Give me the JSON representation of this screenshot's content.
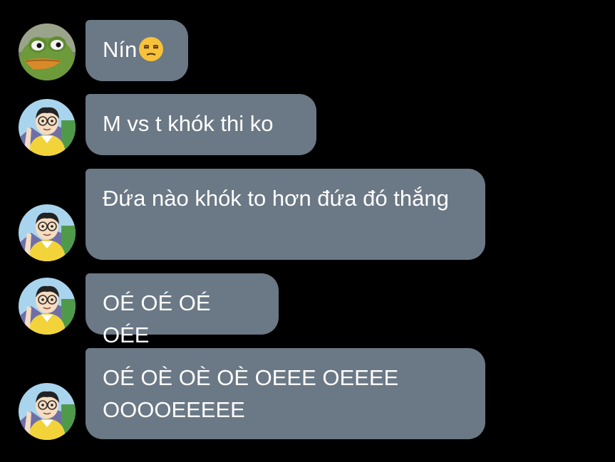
{
  "messages": [
    {
      "text": "Nín",
      "emoji": "unamused-face-emoji",
      "avatar": "frog-avatar"
    },
    {
      "text": "M vs t khók thi ko",
      "avatar": "boy-avatar"
    },
    {
      "text": "Đứa nào khók to hơn đứa đó thắng",
      "avatar": "boy-avatar"
    },
    {
      "text": "OÉ OÉ OÉ OÉE",
      "avatar": "boy-avatar"
    },
    {
      "text": "OÉ OÈ OÈ OÈ OEEE OEEEE OOOOEEEEE",
      "avatar": "boy-avatar"
    }
  ],
  "colors": {
    "background": "#000000",
    "bubble": "#6b7885",
    "text": "#ffffff"
  }
}
